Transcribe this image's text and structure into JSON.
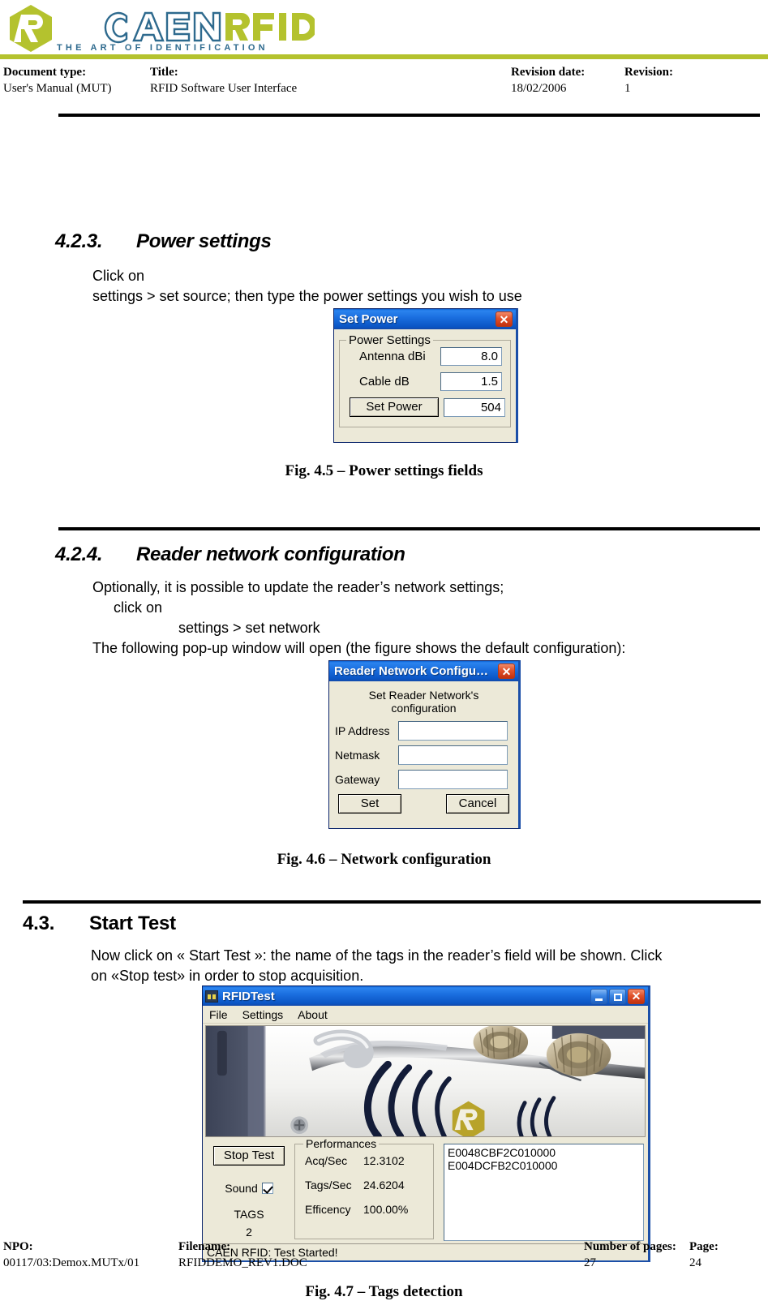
{
  "header": {
    "logo": {
      "brand_caen": "CAEN",
      "brand_rfid": "RFID",
      "tagline": "THE ART OF IDENTIFICATION",
      "mark_letter": "R",
      "green": "#b4c22e",
      "blue": "#2e6a8e"
    },
    "fields": {
      "doctype_label": "Document type:",
      "doctype_value": "User's Manual (MUT)",
      "title_label": "Title:",
      "title_value": "RFID Software User Interface",
      "revdate_label": "Revision date:",
      "revdate_value": "18/02/2006",
      "revision_label": "Revision:",
      "revision_value": "1"
    }
  },
  "sections": {
    "power": {
      "number": "4.2.3.",
      "heading": "Power settings",
      "body_line1": "Click on",
      "body_line2": "settings > set source; then type the power settings you wish to use",
      "caption": "Fig. 4.5 – Power settings fields"
    },
    "network": {
      "number": "4.2.4.",
      "heading": "Reader network configuration",
      "body_line1": "Optionally, it is possible to update  the reader’s network settings;",
      "body_line2": "click on",
      "body_line3": "settings > set network",
      "body_line4": "The following pop-up window will open (the figure shows the default configuration):",
      "caption": "Fig. 4.6 – Network configuration"
    },
    "starttest": {
      "number": "4.3.",
      "heading": "Start Test",
      "body_line1": "Now click on « Start Test »: the name of the tags in the reader’s field will be shown. Click",
      "body_line2": "on «Stop test» in order to stop acquisition.",
      "caption": "Fig. 4.7 – Tags detection"
    }
  },
  "set_power_dialog": {
    "title": "Set Power",
    "close_label": "✕",
    "group_legend": "Power Settings",
    "fields": [
      {
        "label": "Antenna dBi",
        "value": "8.0"
      },
      {
        "label": "Cable dB",
        "value": "1.5"
      }
    ],
    "button_label": "Set Power",
    "result_value": "504"
  },
  "network_dialog": {
    "title": "Reader Network Configu…",
    "close_label": "✕",
    "caption": "Set Reader Network's configuration",
    "fields": [
      {
        "label": "IP Address",
        "value": ""
      },
      {
        "label": "Netmask",
        "value": ""
      },
      {
        "label": "Gateway",
        "value": ""
      }
    ],
    "set_button": "Set",
    "cancel_button": "Cancel"
  },
  "rfidtest_window": {
    "title": "RFIDTest",
    "minimize_label": "_",
    "maximize_label": "□",
    "close_label": "✕",
    "menu": [
      "File",
      "Settings",
      "About"
    ],
    "stop_button": "Stop Test",
    "sound_label": "Sound",
    "sound_checked": true,
    "tags_label": "TAGS",
    "tags_count": "2",
    "performances": {
      "legend": "Performances",
      "rows": [
        {
          "name": "Acq/Sec",
          "value": "12.3102"
        },
        {
          "name": "Tags/Sec",
          "value": "24.6204"
        },
        {
          "name": "Efficency",
          "value": "100.00%"
        }
      ]
    },
    "tag_list": [
      "E0048CBF2C010000",
      "E004DCFB2C010000"
    ],
    "status_text": "CAEN RFID: Test Started!"
  },
  "footer": {
    "npo_label": "NPO:",
    "npo_value": "00117/03:Demox.MUTx/01",
    "filename_label": "Filename:",
    "filename_value": "RFIDDEMO_REV1.DOC",
    "pages_label": "Number of pages:",
    "pages_value": "27",
    "page_label": "Page:",
    "page_value": "24"
  }
}
